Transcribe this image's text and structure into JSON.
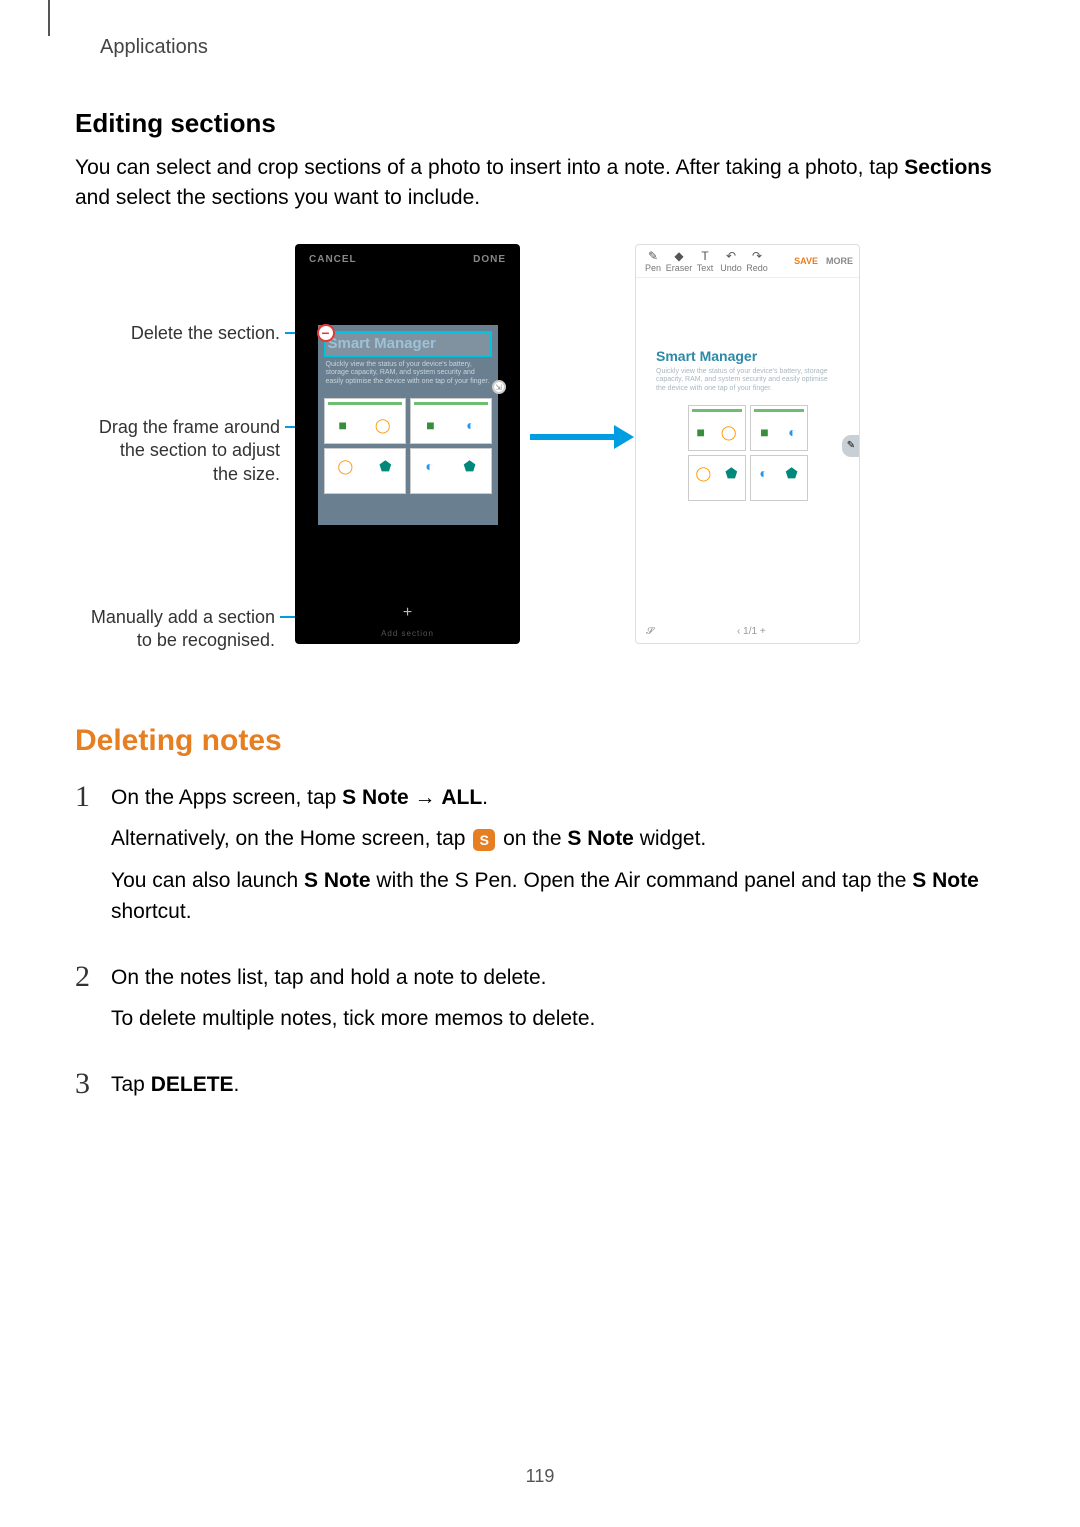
{
  "header": {
    "section": "Applications"
  },
  "editing": {
    "title": "Editing sections",
    "para_pre": "You can select and crop sections of a photo to insert into a note. After taking a photo, tap ",
    "para_bold": "Sections",
    "para_post": " and select the sections you want to include."
  },
  "figure": {
    "callout_delete": "Delete the section.",
    "callout_drag_l1": "Drag the frame around",
    "callout_drag_l2": "the section to adjust",
    "callout_drag_l3": "the size.",
    "callout_add_l1": "Manually add a section",
    "callout_add_l2": "to be recognised.",
    "left": {
      "cancel": "CANCEL",
      "done": "DONE",
      "crop_title": "Smart Manager",
      "crop_sub": "Quickly view the status of your device's battery, storage capacity, RAM, and system security and easily optimise the device with one tap of your finger.",
      "add_symbol": "+",
      "add_label": "Add section"
    },
    "right": {
      "tools": {
        "pen": "Pen",
        "eraser": "Eraser",
        "text": "Text",
        "undo": "Undo",
        "redo": "Redo",
        "save": "SAVE",
        "more": "MORE"
      },
      "note_title": "Smart Manager",
      "note_sub": "Quickly view the status of your device's battery, storage capacity, RAM, and system security and easily optimise the device with one tap of your finger.",
      "pager": "1/1",
      "plus": "+",
      "back": "‹"
    }
  },
  "deleting": {
    "title": "Deleting notes",
    "step1": {
      "pre": "On the Apps screen, tap ",
      "bold1": "S Note",
      "arrow": " → ",
      "bold2": "ALL",
      "post": ".",
      "alt_pre": "Alternatively, on the Home screen, tap ",
      "alt_icon": "S",
      "alt_mid": " on the ",
      "alt_bold": "S Note",
      "alt_post": " widget.",
      "launch_pre": "You can also launch ",
      "launch_bold1": "S Note",
      "launch_mid": " with the S Pen. Open the Air command panel and tap the ",
      "launch_bold2": "S Note",
      "launch_post": " shortcut."
    },
    "step2": {
      "line1": "On the notes list, tap and hold a note to delete.",
      "line2": "To delete multiple notes, tick more memos to delete."
    },
    "step3": {
      "pre": "Tap ",
      "bold": "DELETE",
      "post": "."
    }
  },
  "page_number": "119"
}
